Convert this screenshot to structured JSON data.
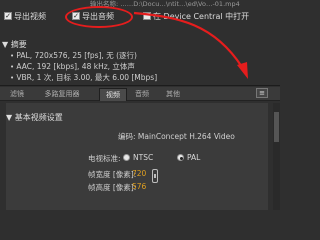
{
  "path_fragment": "输出名称: ……D:\\Docu…\\ntit…\\ed\\Vo…-01.mp4",
  "options": {
    "export_video": {
      "label": "导出视频",
      "checked": true
    },
    "export_audio": {
      "label": "导出音频",
      "checked": true
    },
    "open_in_device_central": {
      "label": "在 Device Central 中打开",
      "checked": false
    }
  },
  "summary": {
    "title": "摘要",
    "lines": [
      "PAL, 720x576, 25 [fps], 无 (逐行)",
      "AAC, 192 [kbps], 48 kHz, 立体声",
      "VBR, 1 次, 目标 3.00, 最大 6.00 [Mbps]"
    ]
  },
  "tabs": [
    {
      "label": "滤镜",
      "active": false
    },
    {
      "label": "多路复用器",
      "active": false
    },
    {
      "label": "视频",
      "active": true
    },
    {
      "label": "音频",
      "active": false
    },
    {
      "label": "其他",
      "active": false
    }
  ],
  "panel_menu_icon": "panel-menu-icon",
  "section": {
    "title": "基本视频设置",
    "codec_label": "编码:",
    "codec_value": "MainConcept H.264 Video",
    "tv_standard_label": "电视标准:",
    "ntsc_label": "NTSC",
    "pal_label": "PAL",
    "tv_standard_selected": "PAL",
    "frame_width_label": "帧宽度 [像素]:",
    "frame_width_value": "720",
    "frame_height_label": "帧高度 [像素]:",
    "frame_height_value": "576"
  },
  "colors": {
    "annotation_red": "#e51d1d",
    "value_orange": "#e0a020"
  }
}
